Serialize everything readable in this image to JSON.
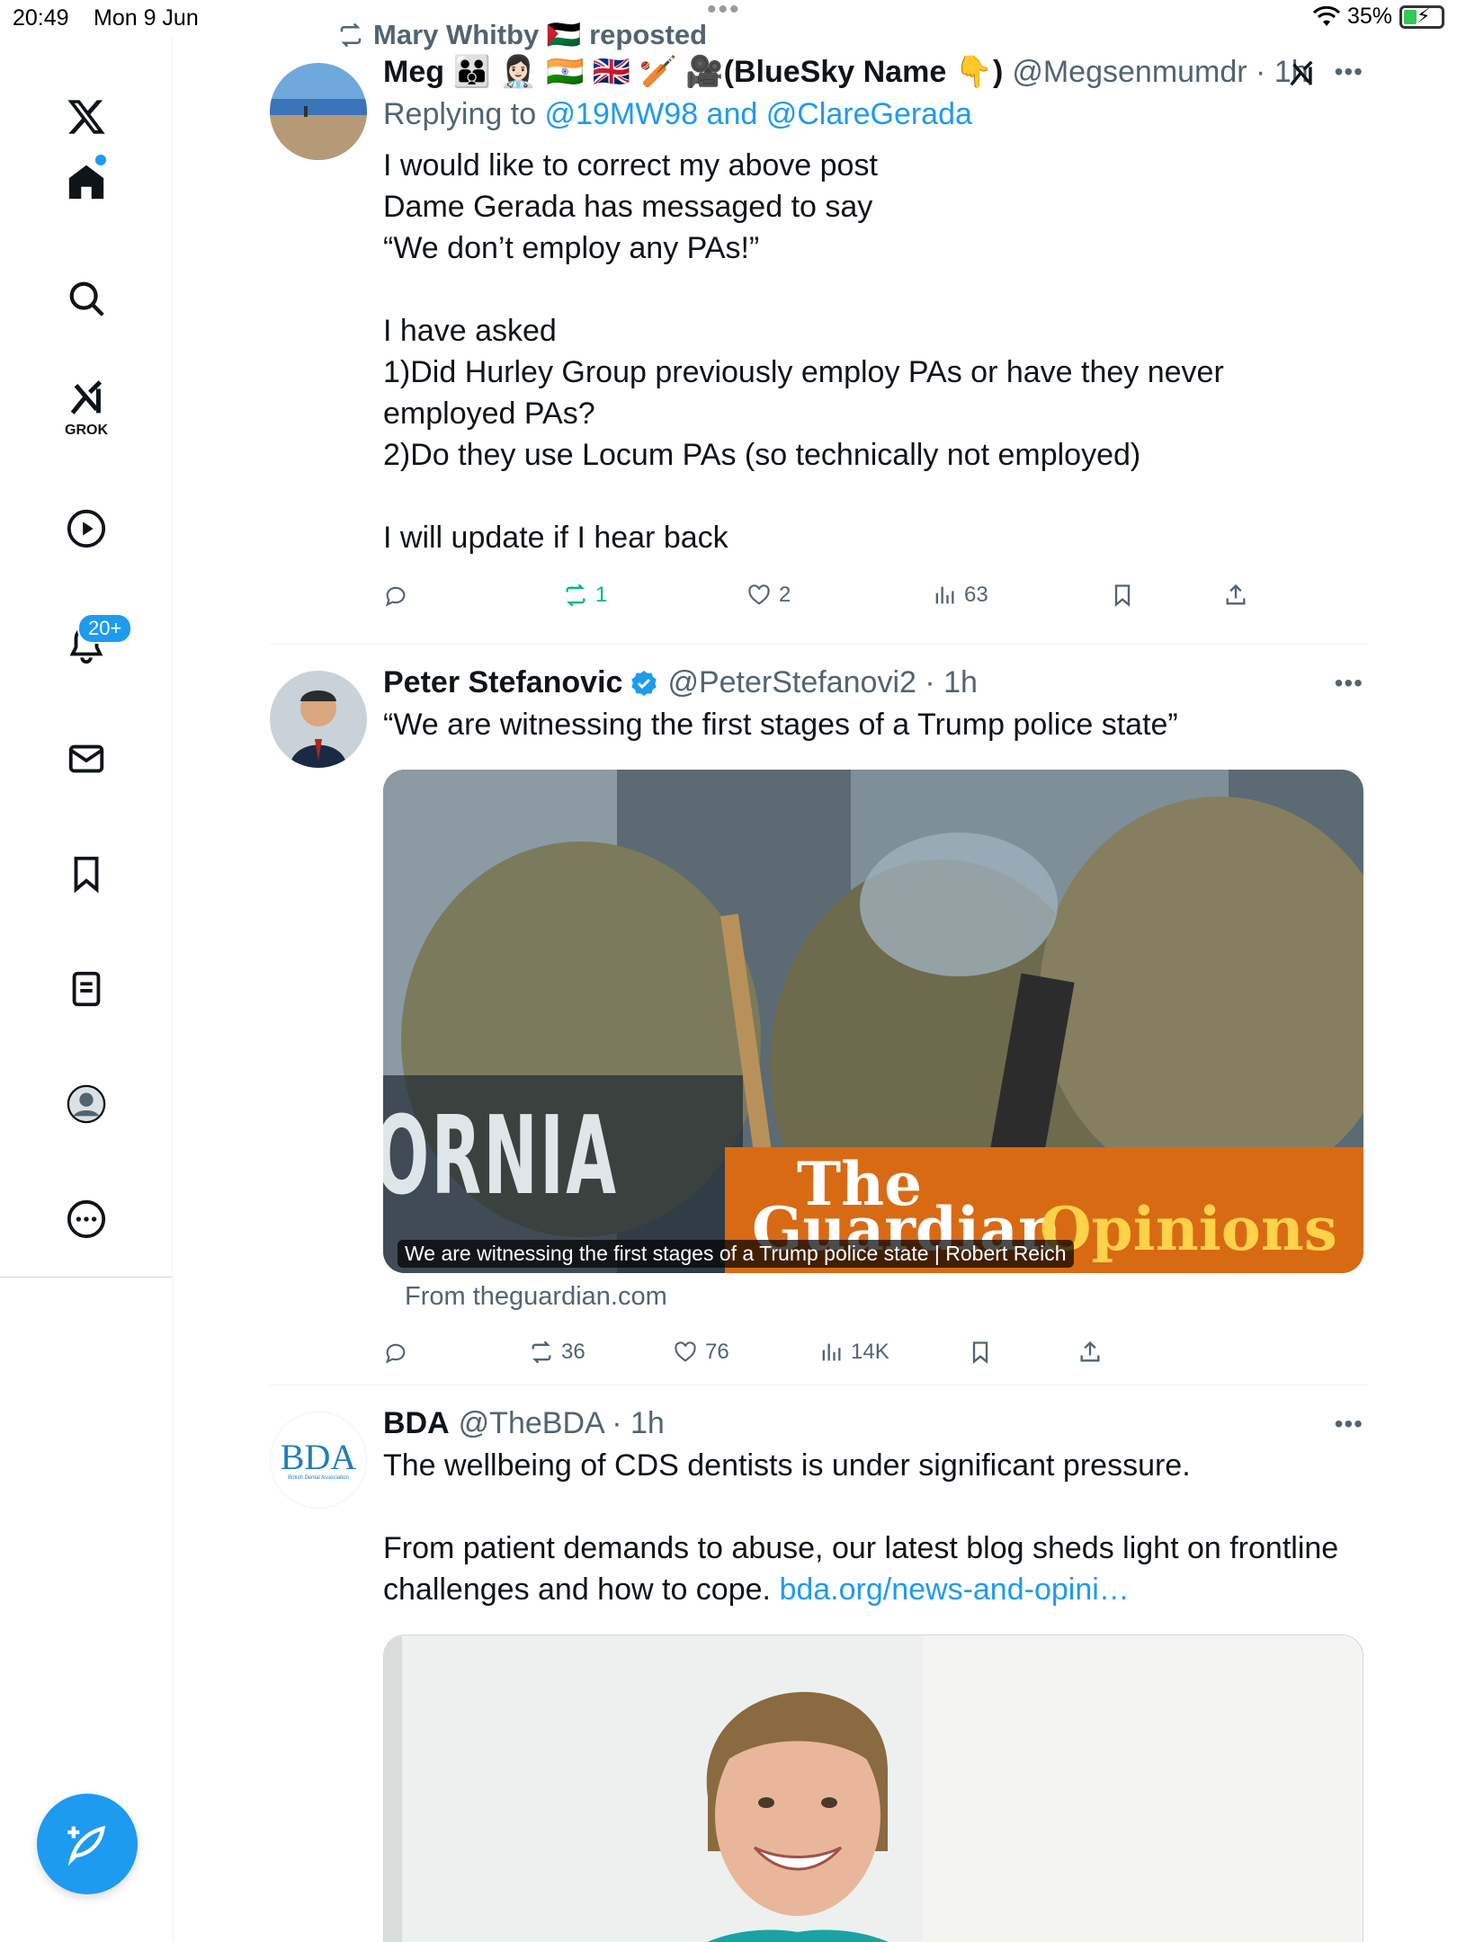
{
  "status_bar": {
    "time": "20:49",
    "date": "Mon 9 Jun",
    "battery": "35%"
  },
  "sidebar": {
    "items": [
      {
        "name": "x-logo"
      },
      {
        "name": "home"
      },
      {
        "name": "search"
      },
      {
        "name": "grok",
        "label": "GROK"
      },
      {
        "name": "video"
      },
      {
        "name": "notifications",
        "badge": "20+"
      },
      {
        "name": "messages"
      },
      {
        "name": "bookmarks"
      },
      {
        "name": "lists"
      },
      {
        "name": "profile"
      },
      {
        "name": "more"
      }
    ]
  },
  "tweets": [
    {
      "repost_by": "Mary Whitby 🇵🇸 reposted",
      "name": "Meg 🧑‍🧑‍🧒 👩🏻‍⚕️ 🇮🇳 🇬🇧 🏏 🎥(BlueSky Name 👇)",
      "handle": "@Megsenmumdr · 1h",
      "reply_prefix": "Replying to ",
      "reply_links": "@19MW98 and @ClareGerada",
      "text": "I would like to correct my above post\nDame Gerada has messaged to say\n“We don’t employ any PAs!”\n\nI have asked\n1)Did Hurley Group previously employ PAs or have they never employed PAs?\n2)Do they use Locum PAs (so technically not employed)\n\nI will update if I hear back",
      "retweets": "1",
      "likes": "2",
      "views": "63"
    },
    {
      "name": "Peter Stefanovic",
      "handle": "@PeterStefanovi2 · 1h",
      "text": "“We are witnessing the first stages of a Trump police state”",
      "card_caption": "We are witnessing the first stages of a Trump police state | Robert Reich",
      "card_from": "From theguardian.com",
      "card_brand_the": "The",
      "card_brand_guardian": "Guardian",
      "card_brand_opinions": "Opinions",
      "card_overlay_text": "ORNIA",
      "retweets": "36",
      "likes": "76",
      "views": "14K"
    },
    {
      "name": "BDA",
      "handle": "@TheBDA · 1h",
      "logo_text": "BDA",
      "logo_sub": "British Dental Association",
      "text1": "The wellbeing of CDS dentists is under significant pressure.",
      "text2": "From patient demands to abuse, our latest blog sheds light on frontline challenges and how to cope. ",
      "link": "bda.org/news-and-opini…"
    }
  ],
  "colors": {
    "accent": "#1d9bf0",
    "repost_active": "#00ba7c",
    "muted": "#536471"
  }
}
